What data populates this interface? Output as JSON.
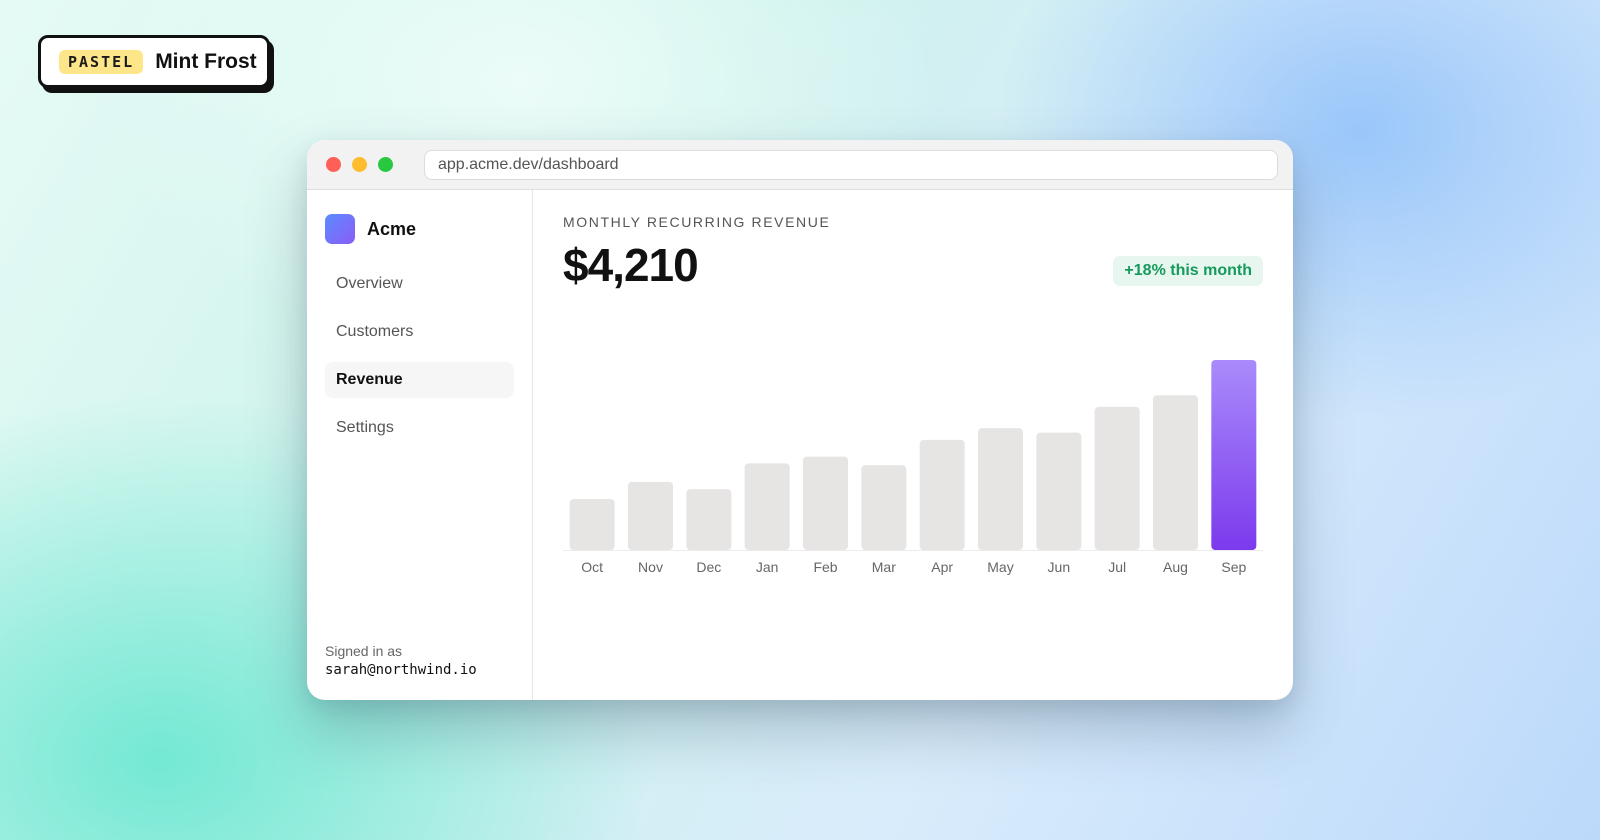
{
  "badge": {
    "tag": "PASTEL",
    "name": "Mint Frost"
  },
  "browser": {
    "url": "app.acme.dev/dashboard"
  },
  "sidebar": {
    "brand": "Acme",
    "items": [
      {
        "label": "Overview",
        "active": false
      },
      {
        "label": "Customers",
        "active": false
      },
      {
        "label": "Revenue",
        "active": true
      },
      {
        "label": "Settings",
        "active": false
      }
    ],
    "signed_in_label": "Signed in as",
    "signed_in_email": "sarah@northwind.io"
  },
  "main": {
    "kpi_label": "MONTHLY RECURRING REVENUE",
    "kpi_value": "$4,210",
    "delta": "+18% this month"
  },
  "colors": {
    "bar_default": "#e6e5e4",
    "bar_highlight_top": "#a98bfa",
    "bar_highlight_bottom": "#7c3aed",
    "delta_text": "#159a5c",
    "delta_bg": "#e7f7ef"
  },
  "chart_data": {
    "type": "bar",
    "categories": [
      "Oct",
      "Nov",
      "Dec",
      "Jan",
      "Feb",
      "Mar",
      "Apr",
      "May",
      "Jun",
      "Jul",
      "Aug",
      "Sep"
    ],
    "values": [
      1130,
      1510,
      1350,
      1920,
      2070,
      1880,
      2440,
      2700,
      2600,
      3170,
      3430,
      4210
    ],
    "highlight_index": 11,
    "ylim": [
      0,
      4210
    ],
    "grid": false,
    "title": "",
    "xlabel": "",
    "ylabel": ""
  }
}
